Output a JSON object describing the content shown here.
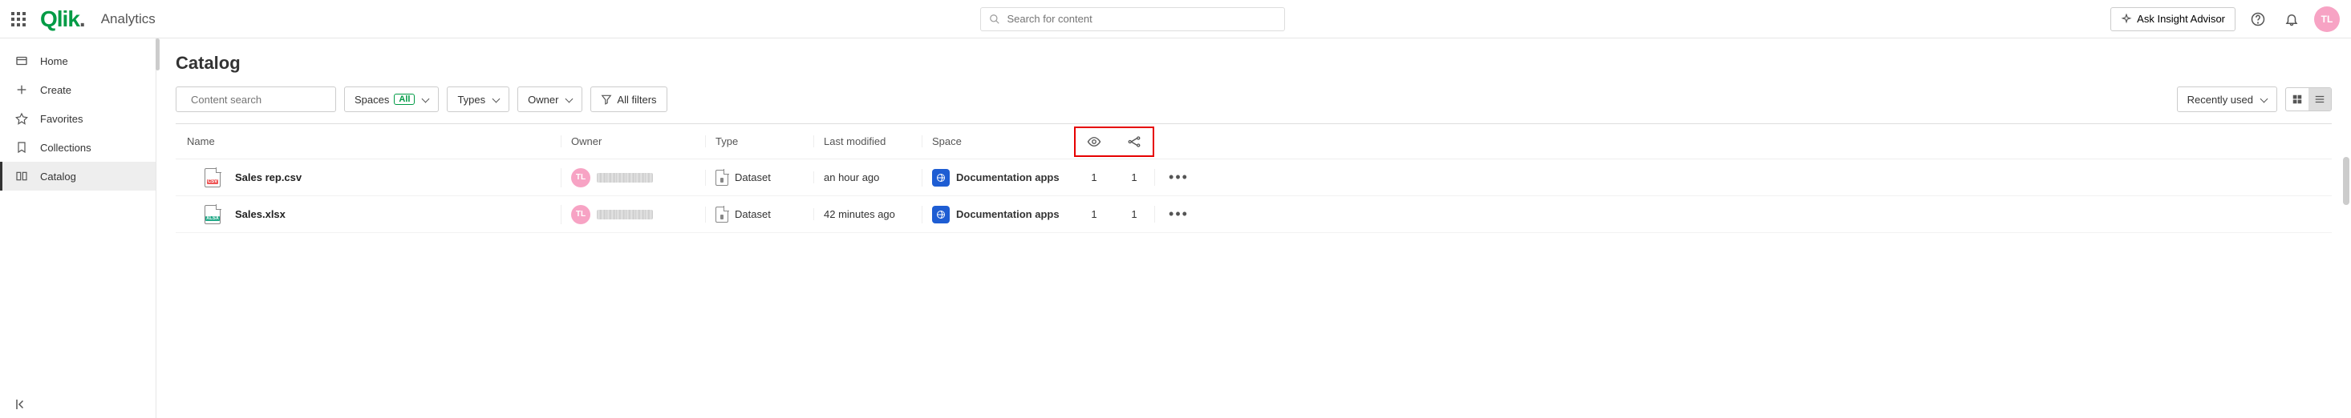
{
  "top": {
    "brand": "Qlik",
    "section": "Analytics",
    "search_placeholder": "Search for content",
    "ask_button": "Ask Insight Advisor",
    "avatar_initials": "TL"
  },
  "sidebar": {
    "items": [
      {
        "label": "Home"
      },
      {
        "label": "Create"
      },
      {
        "label": "Favorites"
      },
      {
        "label": "Collections"
      },
      {
        "label": "Catalog"
      }
    ]
  },
  "page": {
    "title": "Catalog",
    "content_search_placeholder": "Content search",
    "filters": {
      "spaces_label": "Spaces",
      "spaces_badge": "All",
      "types_label": "Types",
      "owner_label": "Owner",
      "all_filters_label": "All filters"
    },
    "sort_label": "Recently used"
  },
  "columns": {
    "name": "Name",
    "owner": "Owner",
    "type": "Type",
    "modified": "Last modified",
    "space": "Space"
  },
  "rows": [
    {
      "filename": "Sales rep.csv",
      "ext": "CSV",
      "owner_initials": "TL",
      "type": "Dataset",
      "modified": "an hour ago",
      "space": "Documentation apps",
      "views": "1",
      "uses": "1"
    },
    {
      "filename": "Sales.xlsx",
      "ext": "XLSX",
      "owner_initials": "TL",
      "type": "Dataset",
      "modified": "42 minutes ago",
      "space": "Documentation apps",
      "views": "1",
      "uses": "1"
    }
  ]
}
